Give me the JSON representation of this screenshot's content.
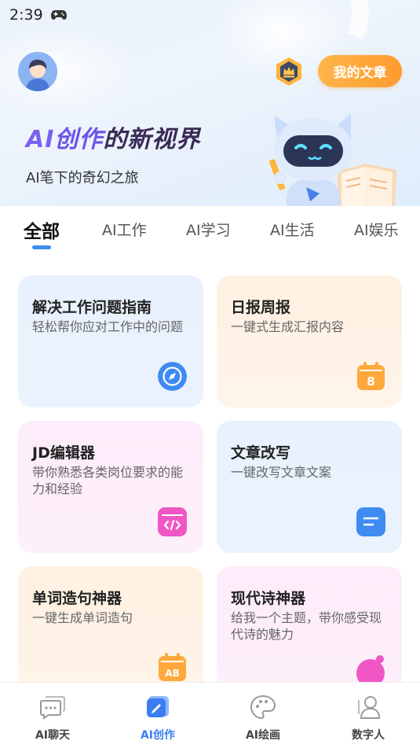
{
  "status_bar": {
    "time": "2:39"
  },
  "header": {
    "my_article_label": "我的文章",
    "banner_title_ai": "AI",
    "banner_title_chuang": "创作",
    "banner_title_rest": "的新视界",
    "banner_subtitle": "AI笔下的奇幻之旅"
  },
  "tabs": [
    {
      "label": "全部",
      "active": true
    },
    {
      "label": "AI工作",
      "active": false
    },
    {
      "label": "AI学习",
      "active": false
    },
    {
      "label": "AI生活",
      "active": false
    },
    {
      "label": "AI娱乐",
      "active": false
    }
  ],
  "cards": [
    {
      "title": "解决工作问题指南",
      "desc": "轻松帮你应对工作中的问题",
      "icon": "compass-icon",
      "icon_color": "#3f8bf2"
    },
    {
      "title": "日报周报",
      "desc": "一键式生成汇报内容",
      "icon": "calendar-icon",
      "icon_color": "#ffa93d",
      "icon_text": "8"
    },
    {
      "title": "JD编辑器",
      "desc": "带你熟悉各类岗位要求的能力和经验",
      "icon": "code-icon",
      "icon_color": "#f057c5"
    },
    {
      "title": "文章改写",
      "desc": "一键改写文章文案",
      "icon": "document-icon",
      "icon_color": "#3f8bf2"
    },
    {
      "title": "单词造句神器",
      "desc": "一键生成单词造句",
      "icon": "ab-calendar-icon",
      "icon_color": "#ffa93d",
      "icon_text": "AB"
    },
    {
      "title": "现代诗神器",
      "desc": "给我一个主题，带你感受现代诗的魅力",
      "icon": "poem-icon",
      "icon_color": "#f057c5"
    }
  ],
  "bottom_nav": [
    {
      "label": "AI聊天",
      "icon": "chat-bubble-icon",
      "active": false
    },
    {
      "label": "AI创作",
      "icon": "creation-icon",
      "active": true
    },
    {
      "label": "AI绘画",
      "icon": "palette-icon",
      "active": false
    },
    {
      "label": "数字人",
      "icon": "digital-human-icon",
      "active": false
    }
  ],
  "colors": {
    "accent": "#3c8df5",
    "button_orange": "#ff9a2e",
    "title_purple": "#7b61f0"
  }
}
